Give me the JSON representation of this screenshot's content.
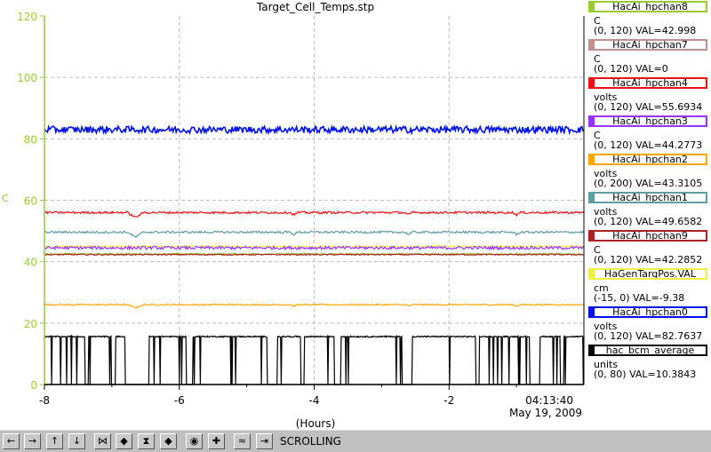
{
  "chart_data": {
    "type": "line",
    "title": "Target_Cell_Temps.stp",
    "ylabel": "C",
    "xlabel": "(Hours)",
    "ylim": [
      0,
      120
    ],
    "xlim": [
      -8,
      0
    ],
    "yticks": [
      "120",
      "100",
      "80",
      "60",
      "40",
      "20",
      "0"
    ],
    "xticks": [
      "-8",
      "-6",
      "-4",
      "-2"
    ],
    "grid": true,
    "time_label": "04:13:40",
    "date_label": "May 19, 2009",
    "axis_color": "#99cc33",
    "series": [
      {
        "name": "HacAi_hpchan8",
        "color": "#99cc33",
        "unit": "C",
        "range": "(0, 120) VAL=42.998",
        "ymin": 0,
        "ymax": 120,
        "level": 42.5,
        "noise": 0.25
      },
      {
        "name": "HacAi_hpchan7",
        "color": "#c09090",
        "unit": "C",
        "range": "(0, 120) VAL=0",
        "ymin": 0,
        "ymax": 120,
        "level": 0,
        "noise": 0
      },
      {
        "name": "HacAi_hpchan4",
        "color": "#ee1111",
        "unit": "volts",
        "range": "(0, 120) VAL=55.6934",
        "ymin": 0,
        "ymax": 120,
        "level": 56.0,
        "noise": 0.35,
        "dips": true
      },
      {
        "name": "HacAi_hpchan3",
        "color": "#9933ff",
        "unit": "C",
        "range": "(0, 120) VAL=44.2773",
        "ymin": 0,
        "ymax": 120,
        "level": 44.5,
        "noise": 0.5
      },
      {
        "name": "HacAi_hpchan2",
        "color": "#ffa500",
        "unit": "volts",
        "range": "(0, 200) VAL=43.3105",
        "ymin": 0,
        "ymax": 200,
        "level": 43.3,
        "noise": 0.35,
        "dips": true
      },
      {
        "name": "HacAi_hpchan1",
        "color": "#5f9ea0",
        "unit": "volts",
        "range": "(0, 120) VAL=49.6582",
        "ymin": 0,
        "ymax": 120,
        "level": 49.6,
        "noise": 0.35,
        "dips": true
      },
      {
        "name": "HacAi_hpchan9",
        "color": "#aa2222",
        "unit": "C",
        "range": "(0, 120) VAL=42.2852",
        "ymin": 0,
        "ymax": 120,
        "level": 42.3,
        "noise": 0.2
      },
      {
        "name": "HaGenTargPos.VAL",
        "color": "#eeee44",
        "unit": "cm",
        "range": "(-15, 0) VAL=-9.38",
        "ymin": -15,
        "ymax": 0,
        "level": -9.38,
        "noise": 0.03
      },
      {
        "name": "HacAi_hpchan0",
        "color": "#0011ee",
        "unit": "volts",
        "range": "(0, 120) VAL=82.7637",
        "ymin": 0,
        "ymax": 120,
        "level": 83.0,
        "noise": 1.1
      },
      {
        "name": "hac_bcm_average",
        "color": "#000000",
        "unit": "units",
        "range": "(0, 80) VAL=10.3843",
        "ymin": 0,
        "ymax": 80,
        "level": 10.4,
        "noise": 0.25,
        "beam": true
      }
    ]
  },
  "toolbar": {
    "status": "SCROLLING",
    "buttons": [
      {
        "name": "scroll-left-button",
        "glyph": "←"
      },
      {
        "name": "scroll-right-button",
        "glyph": "→"
      },
      {
        "name": "scroll-up-button",
        "glyph": "↑"
      },
      {
        "name": "scroll-down-button",
        "glyph": "↓"
      },
      {
        "name": "zoom-in-horizontal-button",
        "glyph": "⋈"
      },
      {
        "name": "zoom-out-horizontal-button",
        "glyph": "◆"
      },
      {
        "name": "zoom-in-vertical-button",
        "glyph": "⧗"
      },
      {
        "name": "zoom-out-vertical-button",
        "glyph": "◆"
      },
      {
        "name": "reset-button",
        "glyph": "◉"
      },
      {
        "name": "crosshair-button",
        "glyph": "✚"
      },
      {
        "name": "autoscale-button",
        "glyph": "≈"
      },
      {
        "name": "scroll-mode-button",
        "glyph": "⇥"
      }
    ]
  }
}
